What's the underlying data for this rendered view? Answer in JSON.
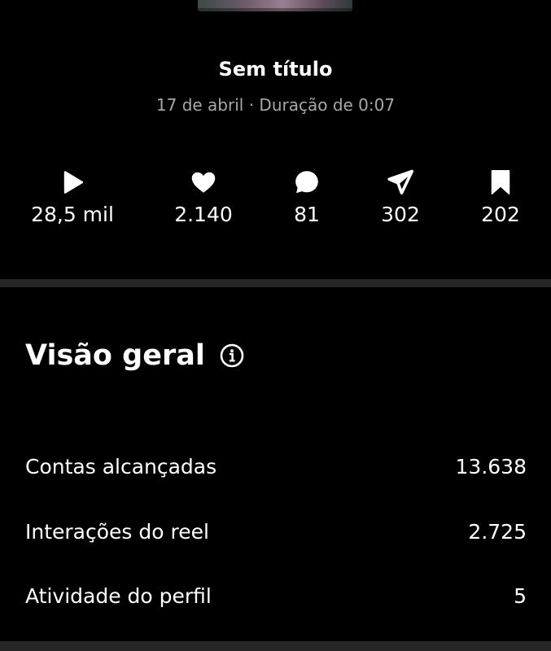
{
  "reel": {
    "title": "Sem título",
    "date": "17 de abril",
    "separator": "·",
    "duration": "Duração de 0:07"
  },
  "stats": [
    {
      "icon": "play-icon",
      "value": "28,5 mil"
    },
    {
      "icon": "heart-icon",
      "value": "2.140"
    },
    {
      "icon": "comment-icon",
      "value": "81"
    },
    {
      "icon": "send-icon",
      "value": "302"
    },
    {
      "icon": "bookmark-icon",
      "value": "202"
    }
  ],
  "overview": {
    "title": "Visão geral",
    "info_icon": "info-icon",
    "rows": [
      {
        "label": "Contas alcançadas",
        "value": "13.638"
      },
      {
        "label": "Interações do reel",
        "value": "2.725"
      },
      {
        "label": "Atividade do perfil",
        "value": "5"
      }
    ]
  },
  "colors": {
    "background": "#000000",
    "text_primary": "#ffffff",
    "text_secondary": "#a8a8a8",
    "divider": "#262626"
  }
}
